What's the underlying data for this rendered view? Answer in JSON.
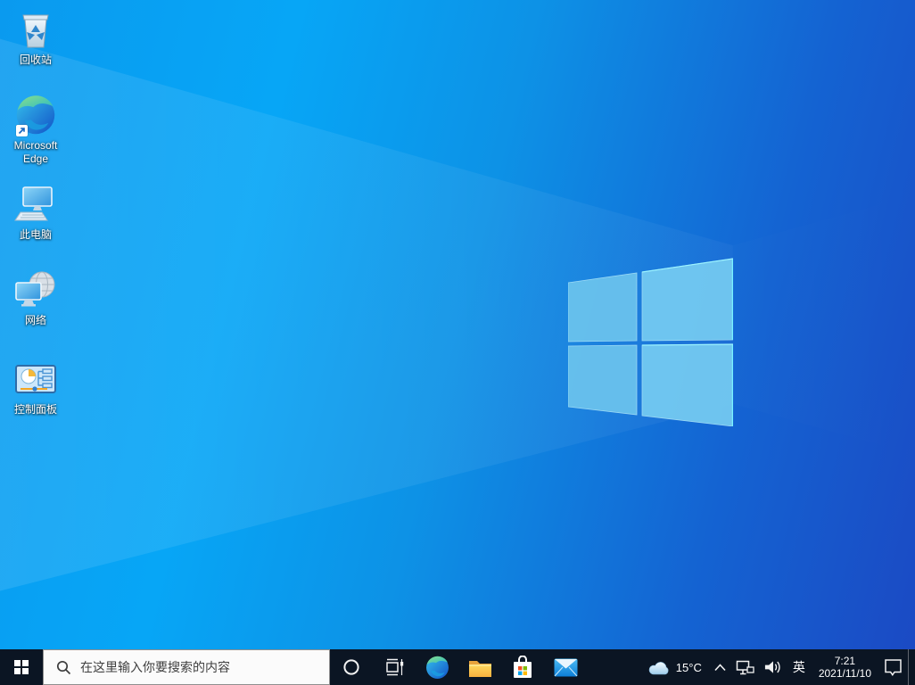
{
  "wallpaper": {
    "base_left_color": "#07a6f6",
    "base_right_color": "#1b4ac4",
    "logo_pane_color": "#6ec6f0",
    "logo_edge_color": "#78f2ff"
  },
  "desktop": {
    "icons": [
      {
        "id": "recycle-bin",
        "label": "回收站"
      },
      {
        "id": "microsoft-edge",
        "label": "Microsoft Edge"
      },
      {
        "id": "this-pc",
        "label": "此电脑"
      },
      {
        "id": "network",
        "label": "网络"
      },
      {
        "id": "control-panel",
        "label": "控制面板"
      }
    ]
  },
  "taskbar": {
    "color": "#0b1523",
    "search": {
      "placeholder": "在这里输入你要搜索的内容"
    },
    "apps": [
      "cortana",
      "task-view",
      "microsoft-edge",
      "file-explorer",
      "microsoft-store",
      "mail"
    ],
    "tray": {
      "weather_temp": "15°C",
      "ime_indicator": "英",
      "time": "7:21",
      "date": "2021/11/10"
    }
  }
}
